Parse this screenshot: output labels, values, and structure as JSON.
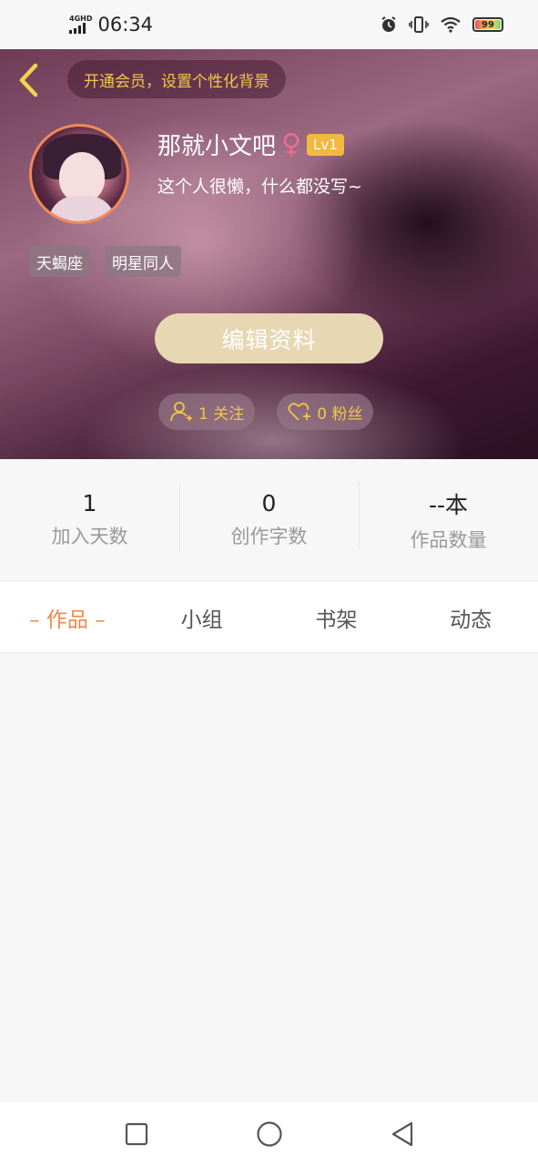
{
  "status_bar": {
    "network": "4GHD",
    "time": "06:34",
    "battery": "99",
    "icons": [
      "alarm-icon",
      "vibrate-icon",
      "wifi-icon",
      "battery-icon"
    ]
  },
  "header": {
    "vip_banner": "开通会员，设置个性化背景",
    "username": "那就小文吧",
    "gender_symbol": "♀",
    "level": "Lv1",
    "bio": "这个人很懒，什么都没写~",
    "tags": [
      "天蝎座",
      "明星同人"
    ],
    "edit_button": "编辑资料",
    "following": "1 关注",
    "followers": "0 粉丝"
  },
  "stats": [
    {
      "value": "1",
      "label": "加入天数"
    },
    {
      "value": "0",
      "label": "创作字数"
    },
    {
      "value": "--本",
      "label": "作品数量"
    }
  ],
  "tabs": [
    "– 作品 –",
    "小组",
    "书架",
    "动态"
  ],
  "colors": {
    "accent": "#f0884a",
    "gold": "#f3c64a",
    "level_badge": "#f3b93f",
    "gender": "#f06b8e",
    "edit_button": "#e7d7b3"
  }
}
